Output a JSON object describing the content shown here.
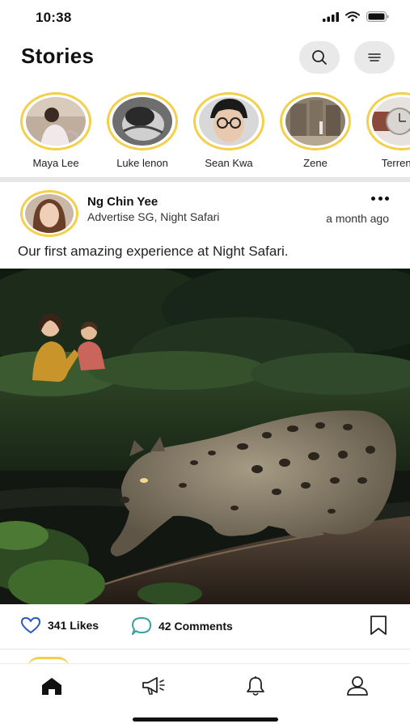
{
  "status_bar": {
    "time": "10:38"
  },
  "header": {
    "title": "Stories",
    "search_icon": "search-icon",
    "menu_icon": "menu-icon"
  },
  "stories": [
    {
      "name": "Maya Lee"
    },
    {
      "name": "Luke lenon"
    },
    {
      "name": "Sean Kwa"
    },
    {
      "name": "Zene"
    },
    {
      "name": "Terrence"
    }
  ],
  "post": {
    "author": "Ng Chin Yee",
    "location": "Advertise SG, Night Safari",
    "time": "a month ago",
    "caption": "Our first amazing experience at Night Safari.",
    "likes": "341 Likes",
    "comments": "42 Comments"
  },
  "tabbar": {
    "items": [
      "home-icon",
      "megaphone-icon",
      "bell-icon",
      "profile-icon"
    ],
    "active": "home-icon"
  },
  "colors": {
    "story_ring": "#f3cf4a",
    "like_icon": "#2b56c4",
    "comment_icon": "#3aa0a0"
  }
}
